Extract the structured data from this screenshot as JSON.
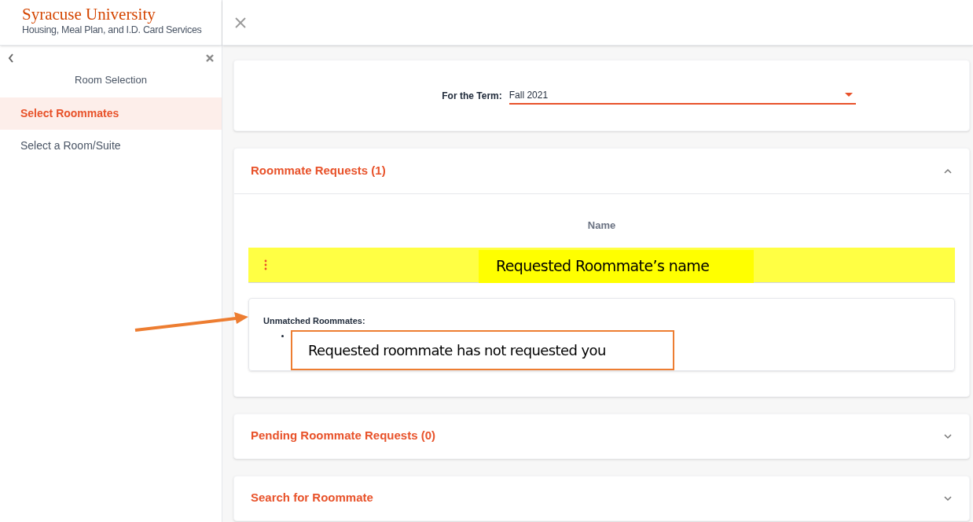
{
  "header": {
    "logo_title": "Syracuse University",
    "logo_subtitle": "Housing, Meal Plan, and I.D. Card Services"
  },
  "sidebar": {
    "section_title": "Room Selection",
    "items": [
      {
        "label": "Select Roommates",
        "selected": true
      },
      {
        "label": "Select a Room/Suite",
        "selected": false
      }
    ]
  },
  "term": {
    "label": "For the Term:",
    "value": "Fall 2021"
  },
  "sections": [
    {
      "title": "Roommate Requests (1)",
      "expanded": true,
      "table": {
        "columns": [
          "Name"
        ],
        "rows": [
          {
            "name": "Requested Roommate’s name"
          }
        ]
      },
      "unmatched": {
        "title": "Unmatched Roommates:",
        "items": [
          "Requested roommate has not requested you"
        ]
      }
    },
    {
      "title": "Pending Roommate Requests (0)",
      "expanded": false
    },
    {
      "title": "Search for Roommate",
      "expanded": false
    }
  ]
}
